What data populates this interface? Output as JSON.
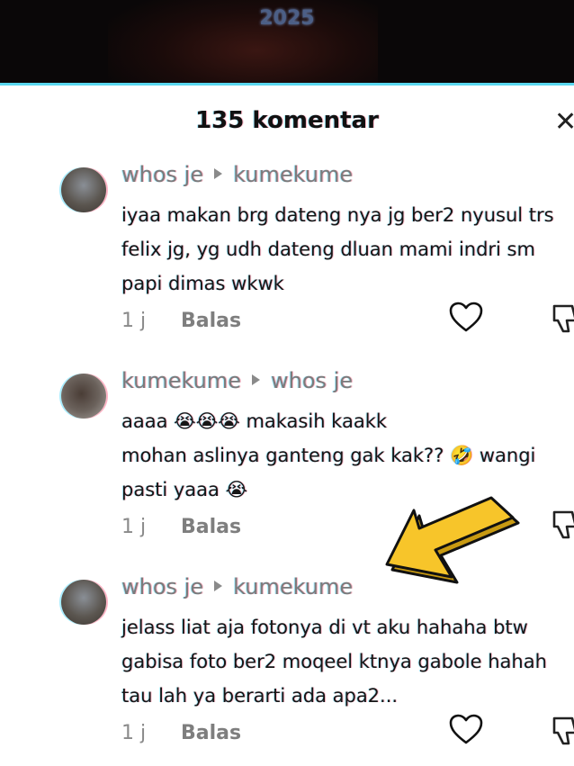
{
  "video": {
    "year": "2025"
  },
  "sheet": {
    "comment_count": "135 komentar",
    "close_icon": "close-icon"
  },
  "comments": [
    {
      "author": "whos je",
      "reply_to": "kumekume",
      "lines": [
        "iyaa makan brg dateng nya jg ber2 nyusul trs",
        "felix jg, yg udh dateng dluan mami indri sm",
        "papi dimas wkwk"
      ],
      "time": "1 j",
      "reply_label": "Balas"
    },
    {
      "author": "kumekume",
      "reply_to": "whos je",
      "lines": [
        "aaaa 😭😭😭 makasih kaakk",
        "mohan aslinya ganteng gak kak?? 🤣 wangi",
        "pasti yaaa 😭"
      ],
      "time": "1 j",
      "reply_label": "Balas"
    },
    {
      "author": "whos je",
      "reply_to": "kumekume",
      "lines": [
        "jelass liat aja fotonya di vt aku hahaha btw",
        "gabisa foto ber2 moqeel ktnya gabole hahah",
        "tau lah ya berarti ada apa2..."
      ],
      "time": "1 j",
      "reply_label": "Balas"
    }
  ],
  "colors": {
    "arrow_fill": "#f7c52a",
    "arrow_stroke": "#111111",
    "accent_line": "#5ad7ef"
  }
}
